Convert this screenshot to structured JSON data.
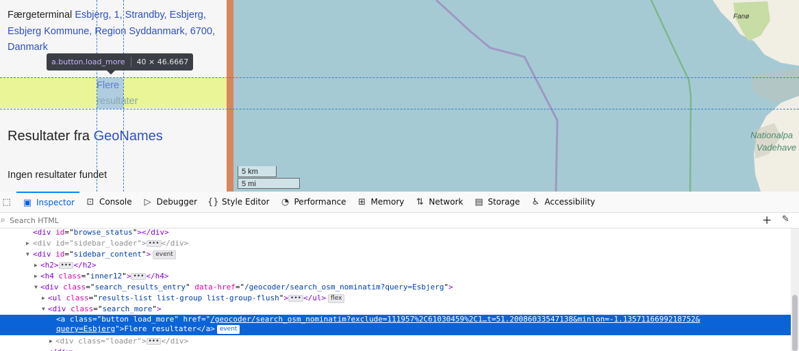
{
  "sidebar": {
    "result_prefix": "Færgeterminal ",
    "result_link": "Esbjerg, 1, Strandby, Esbjerg, Esbjerg Kommune, Region Syddanmark, 6700, Danmark",
    "load_more_line1": "Flere",
    "load_more_line2": "resultater",
    "geo_heading_prefix": "Resultater fra ",
    "geo_heading_link": "GeoNames",
    "no_results": "Ingen resultater fundet"
  },
  "tooltip": {
    "selector": "a.button.load_more",
    "size": "40 × 46.6667"
  },
  "map": {
    "place_fano": "Fanø",
    "place_national_1": "Nationalpa",
    "place_national_2": "Vadehave",
    "scale_km": "5 km",
    "scale_mi": "5 mi",
    "colors": {
      "water": "#a6cad4",
      "land": "#f1eee4",
      "green": "#c8dca5",
      "boundary": "#9b8fc0"
    }
  },
  "devtools": {
    "tabs": [
      {
        "label": "Inspector",
        "icon": "inspector-icon"
      },
      {
        "label": "Console",
        "icon": "console-icon"
      },
      {
        "label": "Debugger",
        "icon": "debugger-icon"
      },
      {
        "label": "Style Editor",
        "icon": "style-editor-icon"
      },
      {
        "label": "Performance",
        "icon": "performance-icon"
      },
      {
        "label": "Memory",
        "icon": "memory-icon"
      },
      {
        "label": "Network",
        "icon": "network-icon"
      },
      {
        "label": "Storage",
        "icon": "storage-icon"
      },
      {
        "label": "Accessibility",
        "icon": "accessibility-icon"
      }
    ],
    "search_placeholder": "Search HTML",
    "tree": {
      "r0": {
        "tag": "div",
        "attr": "id",
        "val": "browse_status"
      },
      "r1": {
        "tag": "div",
        "attr": "id",
        "val": "sidebar_loader"
      },
      "r2": {
        "tag": "div",
        "attr": "id",
        "val": "sidebar_content",
        "badge": "event"
      },
      "r3": {
        "tag": "h2"
      },
      "r4": {
        "tag": "h4",
        "attr": "class",
        "val": "inner12"
      },
      "r5": {
        "tag": "div",
        "attr1": "class",
        "val1": "search_results_entry",
        "attr2": "data-href",
        "val2": "/geocoder/search_osm_nominatim?query=Esbjerg"
      },
      "r6": {
        "tag": "ul",
        "attr": "class",
        "val": "results-list list-group list-group-flush",
        "badge": "flex"
      },
      "r7": {
        "tag": "div",
        "attr": "class",
        "val": "search_more"
      },
      "sel": {
        "tag": "a",
        "attr1": "class",
        "val1": "button load_more",
        "attr2": "href",
        "href1": "/geocoder/search_osm_nominatim?exclude=111957%2C61030459%2C1…t=51.20086033547138&minlon=-1.1357116699218752&",
        "href2": "query=Esbjerg",
        "text": "Flere resultater",
        "badge": "event"
      },
      "r9": {
        "tag": "div",
        "attr": "class",
        "val": "loader"
      },
      "r10": {
        "tag": "div"
      }
    }
  }
}
